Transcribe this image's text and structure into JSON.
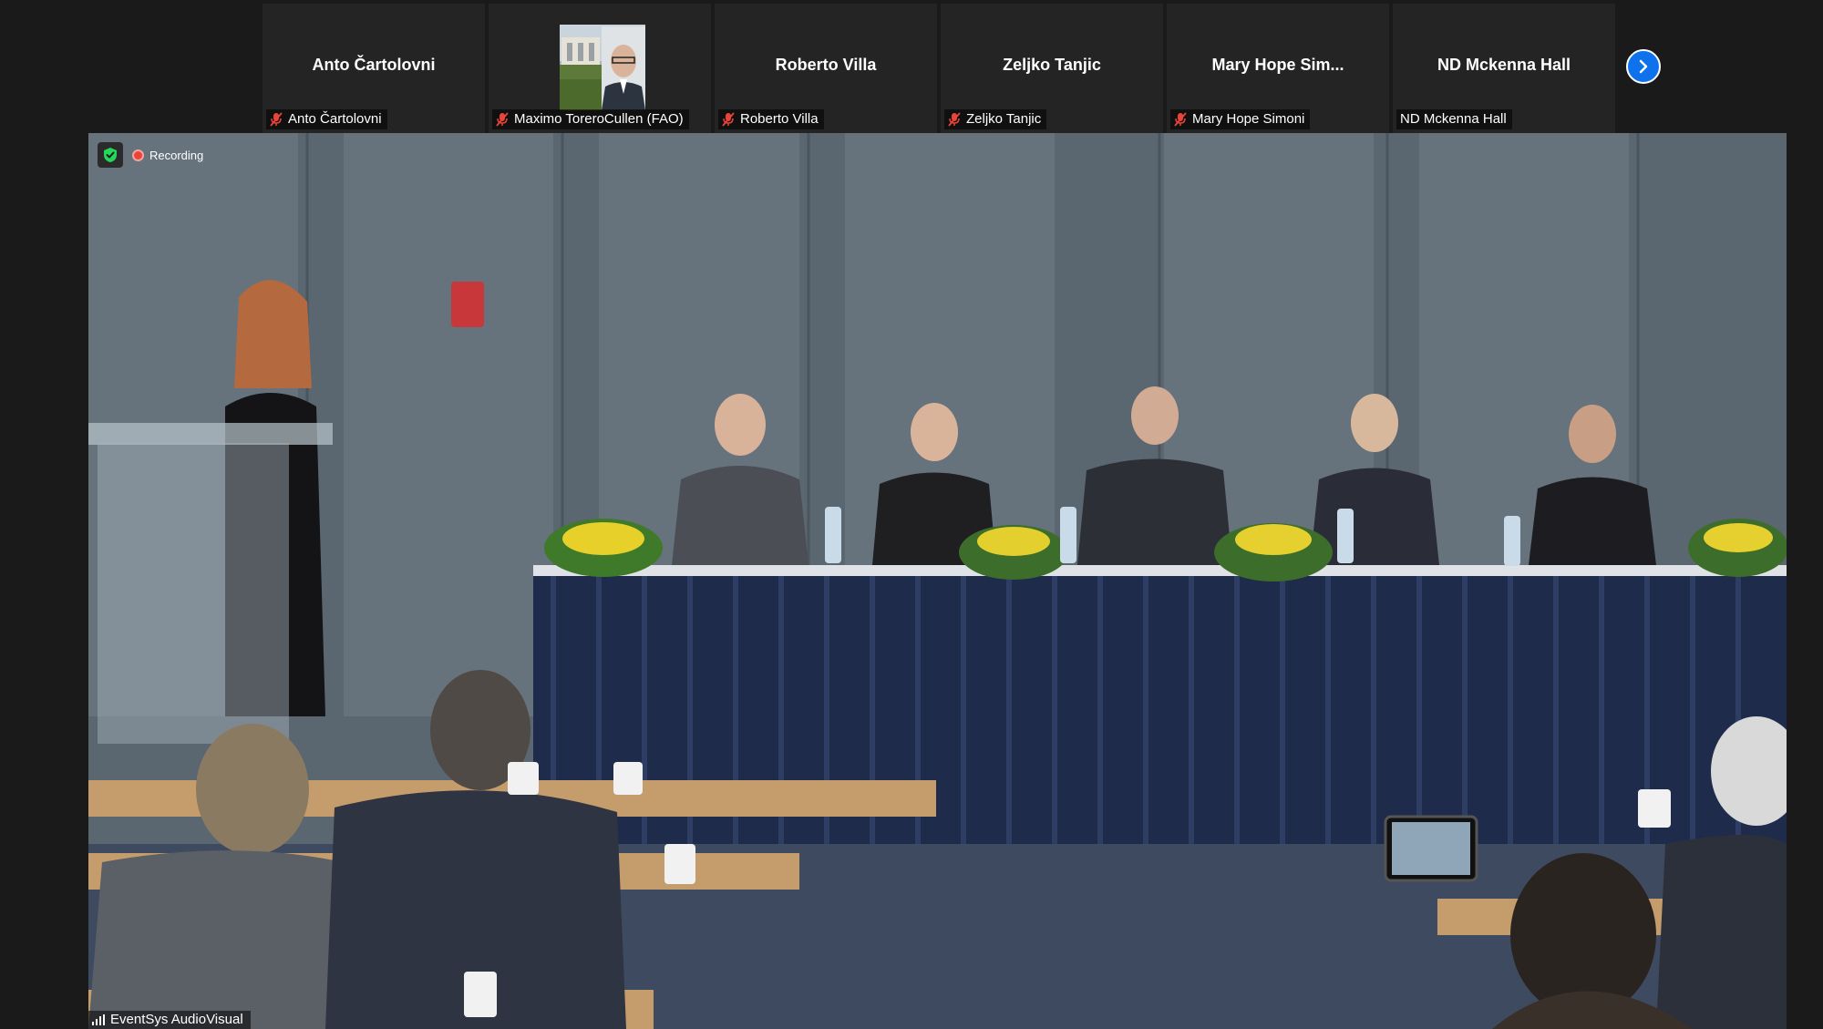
{
  "participants": [
    {
      "display": "Anto Čartolovni",
      "label": "Anto Čartolovni",
      "muted": true,
      "has_video": false
    },
    {
      "display": "",
      "label": "Maximo ToreroCullen (FAO)",
      "muted": true,
      "has_video": true
    },
    {
      "display": "Roberto Villa",
      "label": "Roberto Villa",
      "muted": true,
      "has_video": false
    },
    {
      "display": "Zeljko Tanjic",
      "label": "Zeljko Tanjic",
      "muted": true,
      "has_video": false
    },
    {
      "display": "Mary Hope Sim...",
      "label": "Mary Hope Simoni",
      "muted": true,
      "has_video": false
    },
    {
      "display": "ND Mckenna Hall",
      "label": "ND Mckenna Hall",
      "muted": false,
      "has_video": false
    }
  ],
  "main_video": {
    "recording_label": "Recording",
    "speaker_label": "EventSys AudioVisual"
  },
  "icons": {
    "next_page": "chevron-right-icon",
    "mic": "mic-off-icon",
    "security": "shield-check-icon",
    "signal": "signal-bars-icon"
  },
  "colors": {
    "accent": "#0e72ed",
    "mic_muted": "#e8443a",
    "recording": "#e8443a",
    "shield": "#23d959"
  }
}
